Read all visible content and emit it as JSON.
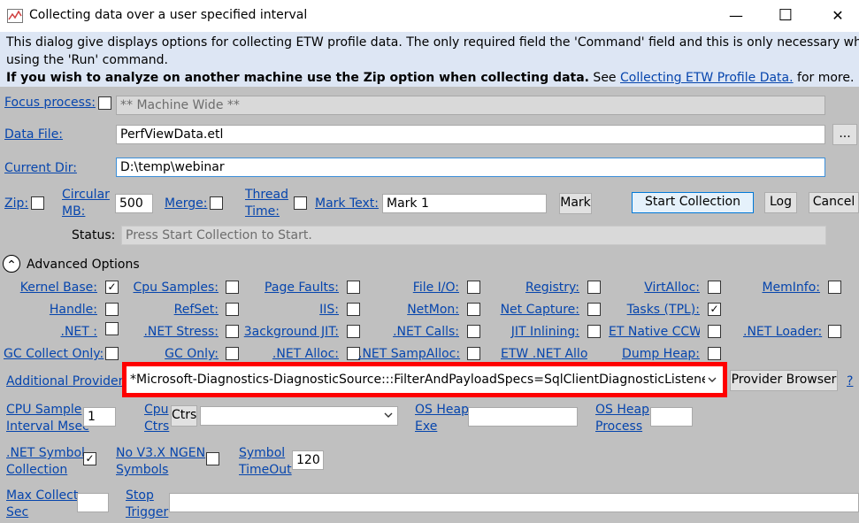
{
  "window": {
    "title": "Collecting data over a user specified interval",
    "minimize_glyph": "—",
    "maximize_glyph": "☐",
    "close_glyph": "✕"
  },
  "info": {
    "line1": "This dialog give displays options for collecting ETW profile data. The only required field the 'Command' field and this is only necessary when",
    "line2": "using the 'Run' command.",
    "line3_bold": "If you wish to analyze on another machine use the Zip option when collecting data.",
    "line3_see": " See ",
    "line3_link": "Collecting ETW Profile Data.",
    "line3_tail": " for more."
  },
  "focus": {
    "label": "Focus process:",
    "value": "** Machine Wide **"
  },
  "datafile": {
    "label": "Data File:",
    "value": "PerfViewData.etl",
    "browse": "..."
  },
  "currentdir": {
    "label": "Current Dir:",
    "value": "D:\\temp\\webinar"
  },
  "row4": {
    "zip": "Zip:",
    "circular1": "Circular",
    "circular2": "MB:",
    "circular_value": "500",
    "merge": "Merge:",
    "thread1": "Thread",
    "thread2": "Time:",
    "marktext": "Mark Text:",
    "marktext_value": "Mark 1",
    "mark_btn": "Mark",
    "start_btn": "Start Collection",
    "log_btn": "Log",
    "cancel_btn": "Cancel"
  },
  "status": {
    "label": "Status:",
    "value": "Press Start Collection to Start."
  },
  "advanced": {
    "label": "Advanced Options",
    "icon": "⌃"
  },
  "checks": {
    "kernel_base": "Kernel Base:",
    "cpu_samples": "Cpu Samples:",
    "page_faults": "Page Faults:",
    "file_io": "File I/O:",
    "registry": "Registry:",
    "virtalloc": "VirtAlloc:",
    "meminfo": "MemInfo:",
    "handle": "Handle:",
    "refset": "RefSet:",
    "iis": "IIS:",
    "netmon": "NetMon:",
    "net_capture": "Net Capture:",
    "tasks_tpl": "Tasks (TPL):",
    "dotnet": ".NET :",
    "net_stress": ".NET Stress:",
    "background_jit": "3ackground JIT:",
    "net_calls": ".NET Calls:",
    "jit_inlining": "JIT Inlining:",
    "et_native_ccw": "ET Native CCW:",
    "net_loader": ".NET Loader:",
    "gc_collect_only": "GC Collect Only:",
    "gc_only": "GC Only:",
    "net_alloc": ".NET Alloc:",
    "net_sampalloc": ".NET SampAlloc:",
    "etw_net_alloc": "ETW .NET Allo",
    "dump_heap": "Dump Heap:",
    "check_mark": "✓"
  },
  "providers": {
    "label": "Additional Providers",
    "value": "*Microsoft-Diagnostics-DiagnosticSource:::FilterAndPayloadSpecs=SqlClientDiagnosticListener/M",
    "browse_btn": "Provider Browser",
    "help": "?"
  },
  "row_cpu": {
    "cpu_sample1": "CPU Sample",
    "cpu_sample2": "Interval Msec",
    "cpu_sample_value": "1",
    "cpu_ctrs1": "Cpu",
    "cpu_ctrs2": "Ctrs",
    "ctrs_btn": "Ctrs",
    "os_heap_exe1": "OS Heap",
    "os_heap_exe2": "Exe",
    "os_heap_proc1": "OS Heap",
    "os_heap_proc2": "Process"
  },
  "row_symbol": {
    "net_symbol1": ".NET Symbol",
    "net_symbol2": "Collection",
    "no_ngen1": "No V3.X NGEN",
    "no_ngen2": "Symbols",
    "symbol_timeout1": "Symbol",
    "symbol_timeout2": "TimeOut",
    "symbol_timeout_value": "120"
  },
  "row_max": {
    "max_collect1": "Max Collect",
    "max_collect2": "Sec",
    "stop_trigger1": "Stop",
    "stop_trigger2": "Trigger"
  }
}
